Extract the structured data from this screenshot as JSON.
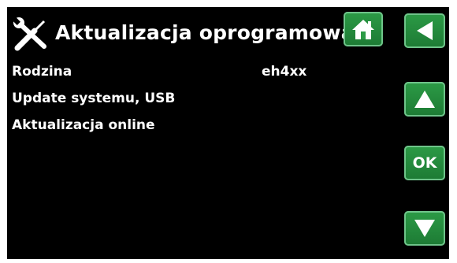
{
  "header": {
    "title": "Aktualizacja oprogramowani",
    "tools_icon": "tools-icon"
  },
  "rows": [
    {
      "label": "Rodzina",
      "value": "eh4xx"
    },
    {
      "label": "Update systemu, USB"
    },
    {
      "label": "Aktualizacja online"
    }
  ],
  "buttons": {
    "home_icon": "home-icon",
    "back_icon": "back-arrow-icon",
    "up_icon": "arrow-up-icon",
    "ok_label": "OK",
    "down_icon": "arrow-down-icon"
  },
  "colors": {
    "background": "#000000",
    "button_green": "#2c9b46",
    "text": "#ffffff"
  }
}
